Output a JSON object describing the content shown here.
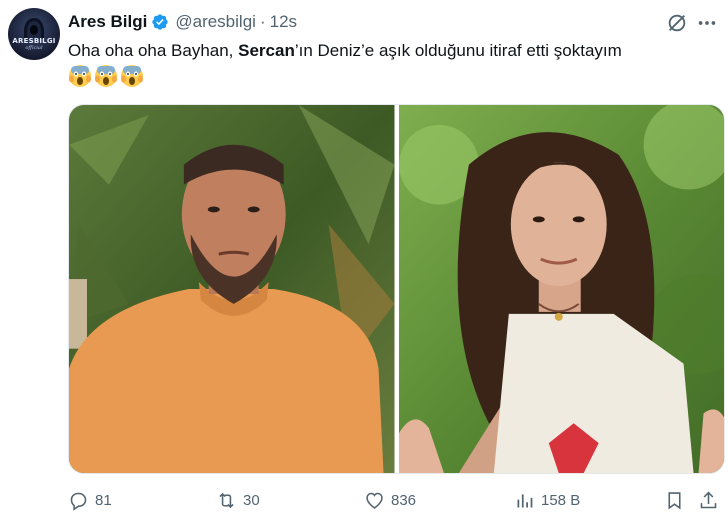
{
  "author": {
    "name": "Ares Bilgi",
    "handle": "@aresbilgi",
    "separator": "·",
    "time": "12s",
    "avatar_text": "ARESBILGI",
    "avatar_subtext": "official"
  },
  "tweet": {
    "text_before": "Oha oha oha Bayhan, ",
    "text_bold": "Sercan",
    "text_after": "’ın Deniz’e aşık olduğunu itiraf etti şoktayım",
    "emoji_icons": [
      "screaming-face-emoji",
      "screaming-face-emoji",
      "screaming-face-emoji"
    ]
  },
  "media": {
    "images": [
      {
        "subject": "man-in-orange-sweater-photo"
      },
      {
        "subject": "woman-in-white-tank-top-photo"
      }
    ]
  },
  "actions": {
    "reply_count": "81",
    "retweet_count": "30",
    "like_count": "836",
    "views_count": "158 B"
  },
  "colors": {
    "verified": "#1d9bf0",
    "text_primary": "#0f1419",
    "text_secondary": "#536471"
  }
}
